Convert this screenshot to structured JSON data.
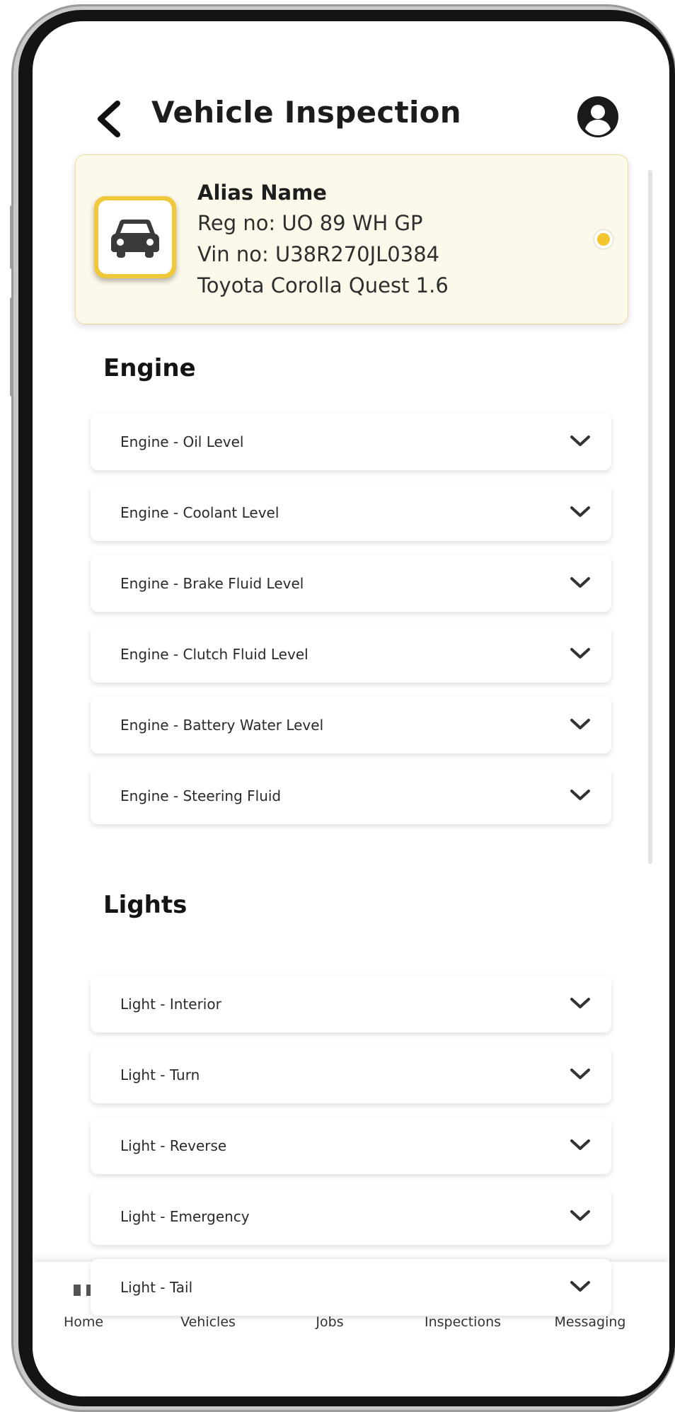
{
  "header": {
    "title": "Vehicle Inspection"
  },
  "vehicle": {
    "alias": "Alias Name",
    "reg": "Reg no: UO 89 WH GP",
    "vin": "Vin no: U38R270JL0384",
    "model": "Toyota Corolla Quest 1.6",
    "selected": true
  },
  "sections": [
    {
      "title": "Engine",
      "items": [
        "Engine - Oil Level",
        "Engine - Coolant Level",
        "Engine - Brake Fluid Level",
        "Engine - Clutch Fluid Level",
        "Engine - Battery Water Level",
        "Engine - Steering Fluid"
      ]
    },
    {
      "title": "Lights",
      "items": [
        "Light - Interior",
        "Light - Turn",
        "Light - Reverse",
        "Light - Emergency",
        "Light - Tail"
      ]
    }
  ],
  "nav": [
    {
      "label": "Home",
      "icon": "home-icon"
    },
    {
      "label": "Vehicles",
      "icon": "car-icon"
    },
    {
      "label": "Jobs",
      "icon": "jobs-icon"
    },
    {
      "label": "Inspections",
      "icon": "inspections-icon",
      "active": true
    },
    {
      "label": "Messaging",
      "icon": "messaging-icon"
    }
  ],
  "colors": {
    "accent": "#f3c630",
    "card_bg": "#fdf9ea",
    "text": "#1c1c1c"
  }
}
